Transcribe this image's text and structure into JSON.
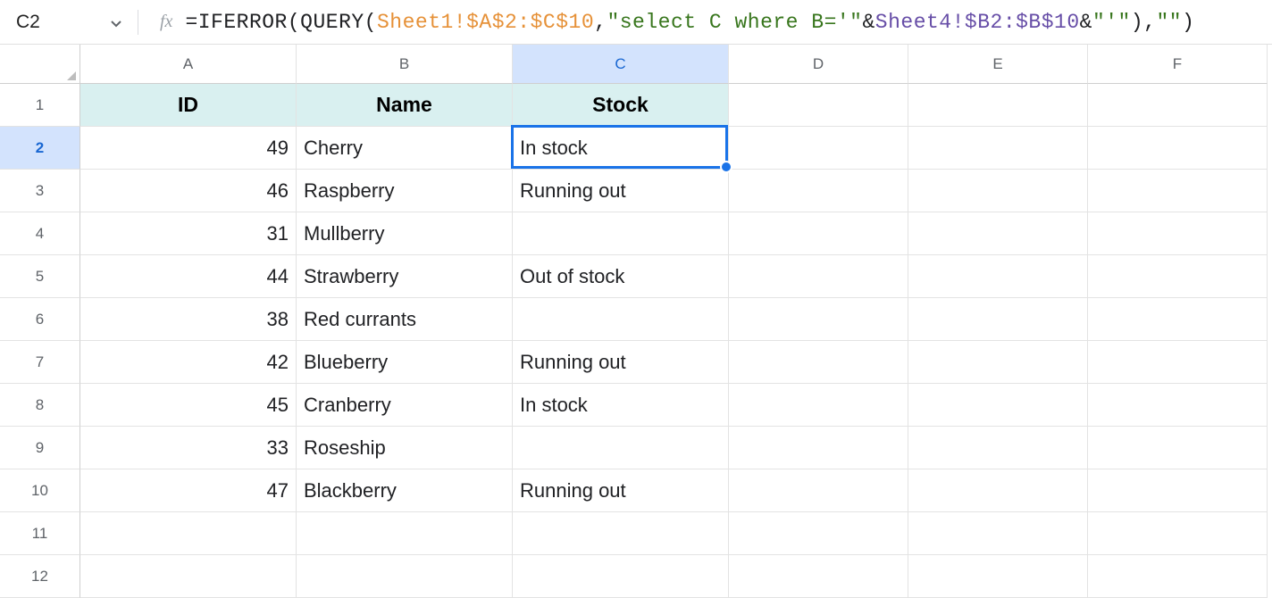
{
  "name_box": "C2",
  "formula": {
    "parts": [
      {
        "cls": "fn-plain",
        "t": "=IFERROR(QUERY("
      },
      {
        "cls": "fn-range",
        "t": "Sheet1!$A$2:$C$10"
      },
      {
        "cls": "fn-plain",
        "t": ","
      },
      {
        "cls": "fn-str",
        "t": "\"select C where B='\""
      },
      {
        "cls": "fn-plain",
        "t": "&"
      },
      {
        "cls": "fn-ref",
        "t": "Sheet4!$B2:$B$10"
      },
      {
        "cls": "fn-plain",
        "t": "&"
      },
      {
        "cls": "fn-str",
        "t": "\"'\""
      },
      {
        "cls": "fn-plain",
        "t": "),"
      },
      {
        "cls": "fn-str",
        "t": "\"\""
      },
      {
        "cls": "fn-plain",
        "t": ")"
      }
    ]
  },
  "columns": [
    "A",
    "B",
    "C",
    "D",
    "E",
    "F"
  ],
  "selected_column": "C",
  "selected_row": 2,
  "header_row": {
    "A": "ID",
    "B": "Name",
    "C": "Stock"
  },
  "rows": [
    {
      "n": 1,
      "A": "ID",
      "B": "Name",
      "C": "Stock",
      "hdr": true
    },
    {
      "n": 2,
      "A": "49",
      "B": "Cherry",
      "C": "In stock"
    },
    {
      "n": 3,
      "A": "46",
      "B": "Raspberry",
      "C": "Running out"
    },
    {
      "n": 4,
      "A": "31",
      "B": "Mullberry",
      "C": ""
    },
    {
      "n": 5,
      "A": "44",
      "B": "Strawberry",
      "C": "Out of stock"
    },
    {
      "n": 6,
      "A": "38",
      "B": "Red currants",
      "C": ""
    },
    {
      "n": 7,
      "A": "42",
      "B": "Blueberry",
      "C": "Running out"
    },
    {
      "n": 8,
      "A": "45",
      "B": "Cranberry",
      "C": "In stock"
    },
    {
      "n": 9,
      "A": "33",
      "B": "Roseship",
      "C": ""
    },
    {
      "n": 10,
      "A": "47",
      "B": "Blackberry",
      "C": "Running out"
    },
    {
      "n": 11,
      "A": "",
      "B": "",
      "C": ""
    },
    {
      "n": 12,
      "A": "",
      "B": "",
      "C": ""
    }
  ]
}
